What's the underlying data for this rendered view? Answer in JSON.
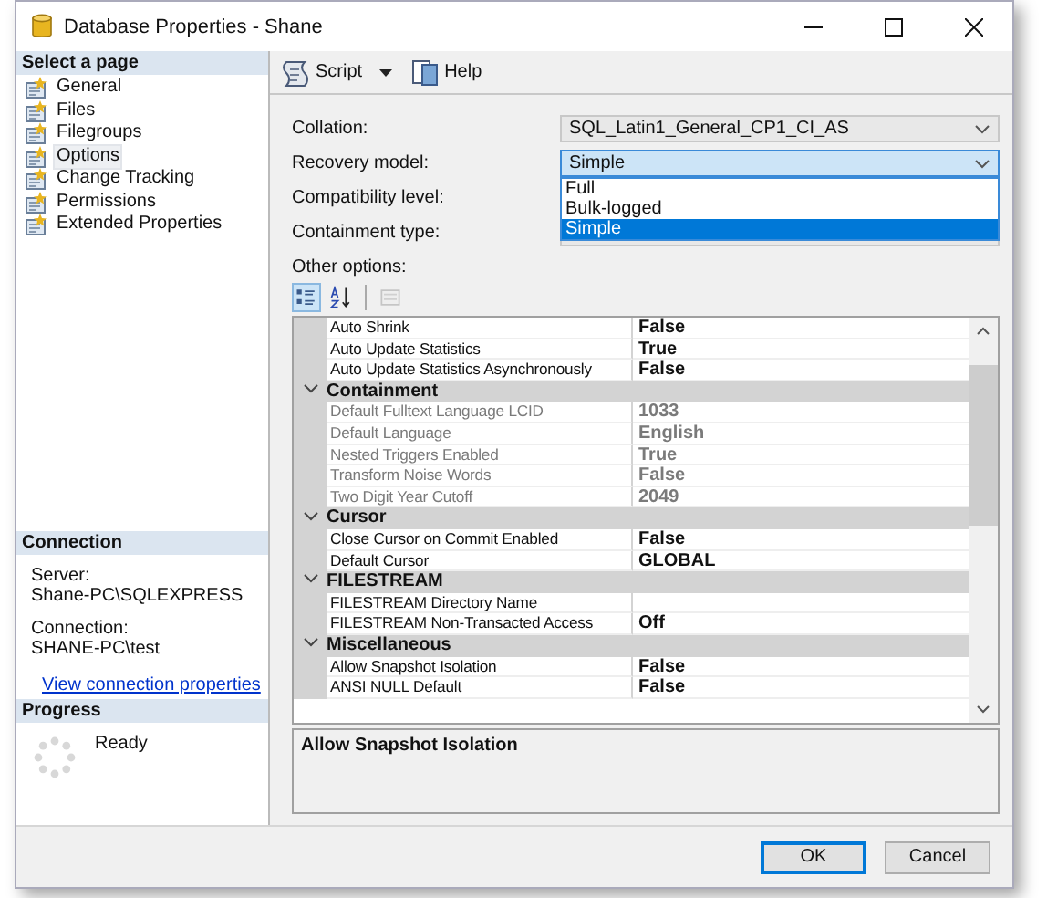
{
  "window": {
    "title": "Database Properties - Shane"
  },
  "sidebar": {
    "header": "Select a page",
    "items": [
      {
        "label": "General",
        "selected": false
      },
      {
        "label": "Files",
        "selected": false
      },
      {
        "label": "Filegroups",
        "selected": false
      },
      {
        "label": "Options",
        "selected": true
      },
      {
        "label": "Change Tracking",
        "selected": false
      },
      {
        "label": "Permissions",
        "selected": false
      },
      {
        "label": "Extended Properties",
        "selected": false
      }
    ]
  },
  "connection": {
    "header": "Connection",
    "fields": [
      {
        "label": "Server:",
        "value": "Shane-PC\\SQLEXPRESS"
      },
      {
        "label": "Connection:",
        "value": "SHANE-PC\\test"
      }
    ],
    "link": "View connection properties"
  },
  "progress": {
    "header": "Progress",
    "status": "Ready"
  },
  "toolbar": {
    "buttons": [
      {
        "label": "Script",
        "kind": "split"
      },
      {
        "label": "Help",
        "kind": "plain"
      }
    ]
  },
  "form": {
    "fields": [
      {
        "label": "Collation:",
        "value": "SQL_Latin1_General_CP1_CI_AS",
        "focused": false
      },
      {
        "label": "Recovery model:",
        "value": "Simple",
        "focused": true,
        "options": [
          {
            "label": "Full",
            "selected": false
          },
          {
            "label": "Bulk-logged",
            "selected": false
          },
          {
            "label": "Simple",
            "selected": true
          }
        ]
      },
      {
        "label": "Compatibility level:"
      },
      {
        "label": "Containment type:",
        "focused": false
      }
    ]
  },
  "other_options": {
    "label": "Other options:",
    "view_buttons": [
      {
        "kind": "categorized",
        "selected": true,
        "disabled": false
      },
      {
        "kind": "alphabetical",
        "selected": false,
        "disabled": false
      },
      {
        "kind": "pages",
        "selected": false,
        "disabled": true
      }
    ]
  },
  "grid": {
    "rows": [
      {
        "kind": "property",
        "name": "Auto Shrink",
        "value": "False",
        "disabled": false
      },
      {
        "kind": "property",
        "name": "Auto Update Statistics",
        "value": "True",
        "disabled": false
      },
      {
        "kind": "property",
        "name": "Auto Update Statistics Asynchronously",
        "value": "False",
        "disabled": false
      },
      {
        "kind": "category",
        "name": "Containment",
        "expanded": true
      },
      {
        "kind": "property",
        "name": "Default Fulltext Language LCID",
        "value": "1033",
        "disabled": true
      },
      {
        "kind": "property",
        "name": "Default Language",
        "value": "English",
        "disabled": true
      },
      {
        "kind": "property",
        "name": "Nested Triggers Enabled",
        "value": "True",
        "disabled": true
      },
      {
        "kind": "property",
        "name": "Transform Noise Words",
        "value": "False",
        "disabled": true
      },
      {
        "kind": "property",
        "name": "Two Digit Year Cutoff",
        "value": "2049",
        "disabled": true
      },
      {
        "kind": "category",
        "name": "Cursor",
        "expanded": true
      },
      {
        "kind": "property",
        "name": "Close Cursor on Commit Enabled",
        "value": "False",
        "disabled": false
      },
      {
        "kind": "property",
        "name": "Default Cursor",
        "value": "GLOBAL",
        "disabled": false
      },
      {
        "kind": "category",
        "name": "FILESTREAM",
        "expanded": true
      },
      {
        "kind": "property",
        "name": "FILESTREAM Directory Name",
        "disabled": false
      },
      {
        "kind": "property",
        "name": "FILESTREAM Non-Transacted Access",
        "value": "Off",
        "disabled": false
      },
      {
        "kind": "category",
        "name": "Miscellaneous",
        "expanded": true
      },
      {
        "kind": "property",
        "name": "Allow Snapshot Isolation",
        "value": "False",
        "disabled": false
      },
      {
        "kind": "property",
        "name": "ANSI NULL Default",
        "value": "False",
        "disabled": false
      }
    ]
  },
  "description": {
    "title": "Allow Snapshot Isolation"
  },
  "buttons": [
    {
      "label": "OK",
      "default": true
    },
    {
      "label": "Cancel",
      "default": false
    }
  ]
}
